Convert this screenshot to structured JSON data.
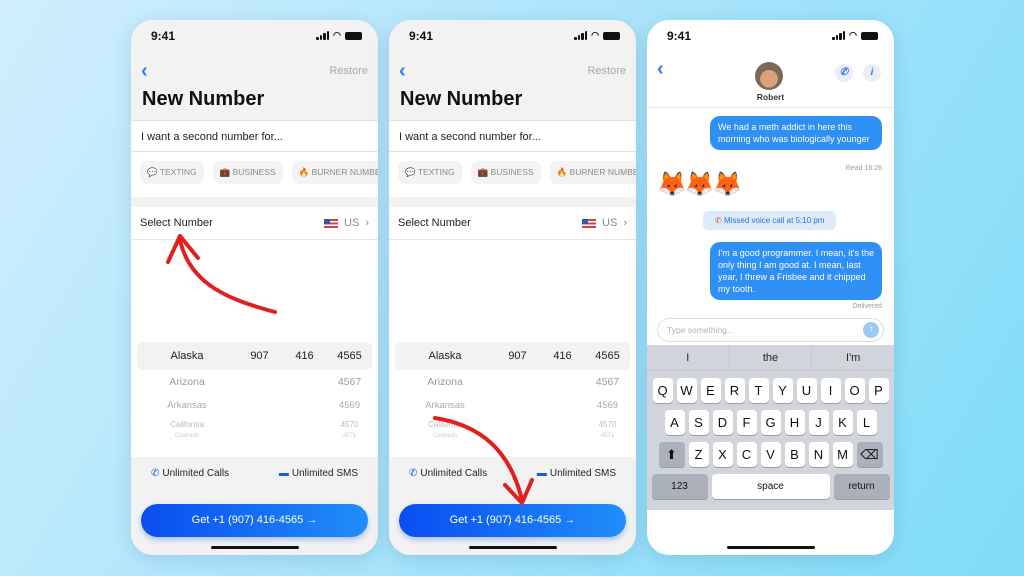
{
  "status": {
    "time": "9:41"
  },
  "new_number": {
    "restore": "Restore",
    "title": "New Number",
    "prompt": "I want a second number for...",
    "chips": [
      {
        "icon": "chat-bubble-icon",
        "glyph": "💬",
        "label": "TEXTING"
      },
      {
        "icon": "briefcase-icon",
        "glyph": "💼",
        "label": "BUSINESS"
      },
      {
        "icon": "flame-phone-icon",
        "glyph": "🔥",
        "label": "BURNER NUMBER"
      }
    ],
    "select_label": "Select Number",
    "country": "US",
    "picker": [
      [
        "Alaska",
        "907",
        "416",
        "4565"
      ],
      [
        "Arizona",
        "",
        "",
        "4567"
      ],
      [
        "Arkansas",
        "",
        "",
        "4569"
      ],
      [
        "California",
        "",
        "",
        "4570"
      ],
      [
        "Colorado",
        "",
        "",
        "4571"
      ]
    ],
    "features": [
      "Unlimited Calls",
      "Unlimited SMS"
    ],
    "cta": "Get +1 (907) 416-4565 →"
  },
  "chat": {
    "contact": "Robert",
    "messages": [
      {
        "text": "We had a meth addict in here this morning who was biologically younger",
        "meta": "Read 16:26"
      },
      {
        "text": "I'm a good programmer. I mean, it's the only thing I am good at. I mean, last year, I threw a Frisbee and it chipped my tooth.",
        "meta": "Delivered"
      }
    ],
    "emoji": "🦊🦊🦊",
    "missed_call": "Missed voice call at 5:10 pm",
    "input_placeholder": "Type something...",
    "suggestions": [
      "I",
      "the",
      "I'm"
    ],
    "keys": [
      [
        "Q",
        "W",
        "E",
        "R",
        "T",
        "Y",
        "U",
        "I",
        "O",
        "P"
      ],
      [
        "A",
        "S",
        "D",
        "F",
        "G",
        "H",
        "J",
        "K",
        "L"
      ],
      [
        "Z",
        "X",
        "C",
        "V",
        "B",
        "N",
        "M"
      ]
    ],
    "key_123": "123",
    "key_space": "space",
    "key_return": "return"
  },
  "colors": {
    "accent": "#2f7cf6",
    "bubble": "#2e8ff4",
    "annotation_arrow": "#e0201c"
  }
}
